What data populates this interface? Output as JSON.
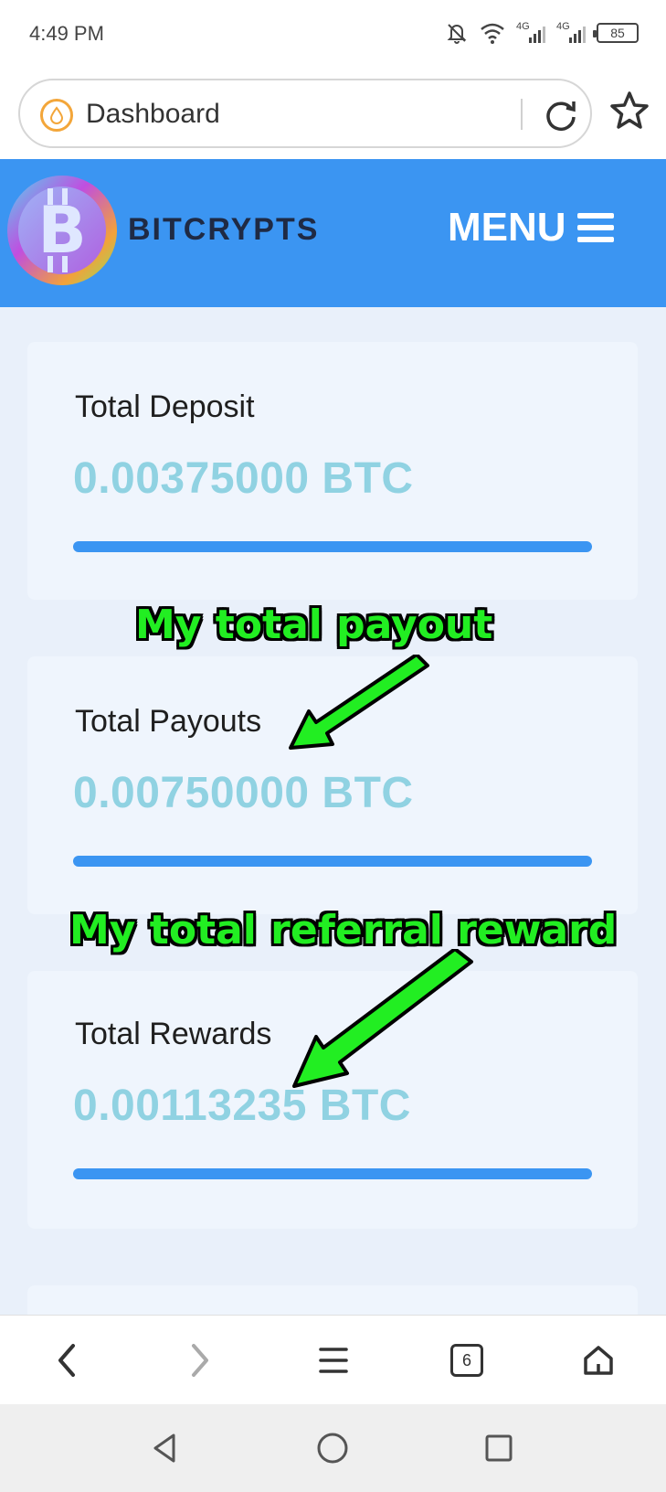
{
  "status_bar": {
    "time": "4:49 PM",
    "signal1_label": "4G",
    "signal2_label": "4G",
    "battery": "85",
    "icons": [
      "mute-bell-icon",
      "wifi-icon",
      "signal-icon",
      "signal-icon",
      "battery-icon"
    ]
  },
  "browser": {
    "page_title": "Dashboard",
    "site_icon": "droplet-icon",
    "reload_icon": "reload-icon",
    "bookmark_icon": "star-icon"
  },
  "site": {
    "brand": "BITCRYPTS",
    "logo_icon": "bitcoin-logo",
    "menu_label": "MENU",
    "menu_icon": "hamburger-icon",
    "header_color": "#3b95f2"
  },
  "cards": [
    {
      "title": "Total Deposit",
      "value": "0.00375000 BTC"
    },
    {
      "title": "Total Payouts",
      "value": "0.00750000 BTC"
    },
    {
      "title": "Total Rewards",
      "value": "0.00113235 BTC"
    }
  ],
  "annotations": {
    "payout": "My total payout",
    "referral": "My total referral reward",
    "color": "#22ee22"
  },
  "browser_nav": {
    "tab_count": "6",
    "icons": [
      "back-icon",
      "forward-icon",
      "menu-icon",
      "tabs-icon",
      "home-icon"
    ]
  },
  "system_nav": {
    "icons": [
      "back-triangle-icon",
      "home-circle-icon",
      "recents-square-icon"
    ]
  }
}
